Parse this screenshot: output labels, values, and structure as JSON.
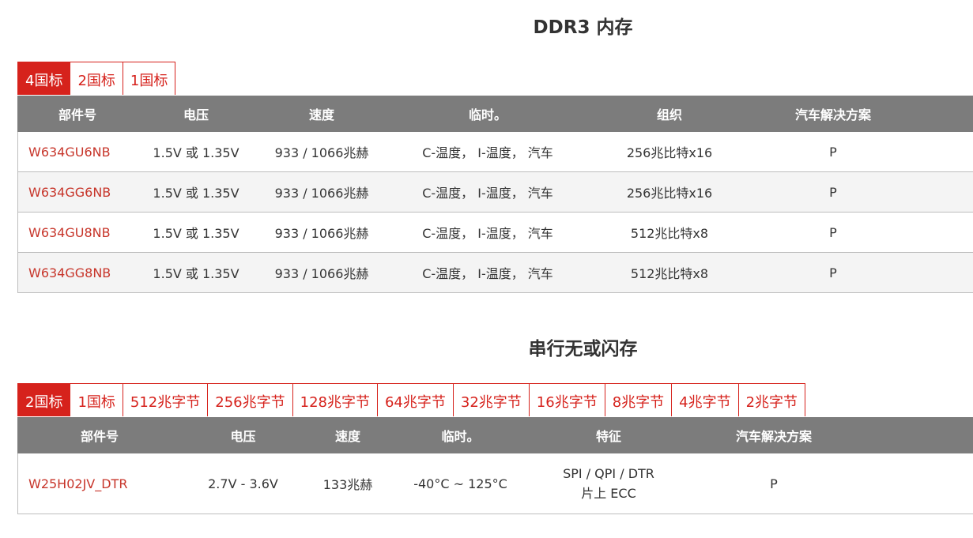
{
  "ddr3": {
    "title": "DDR3 内存",
    "tabs": [
      "4国标",
      "2国标",
      "1国标"
    ],
    "headers": [
      "部件号",
      "电压",
      "速度",
      "临时。",
      "组织",
      "汽车解决方案"
    ],
    "rows": [
      {
        "part": "W634GU6NB",
        "voltage": "1.5V 或 1.35V",
        "speed": "933 / 1066兆赫",
        "temp": "C-温度， I-温度， 汽车",
        "org": "256兆比特x16",
        "auto": "P"
      },
      {
        "part": "W634GG6NB",
        "voltage": "1.5V 或 1.35V",
        "speed": "933 / 1066兆赫",
        "temp": "C-温度， I-温度， 汽车",
        "org": "256兆比特x16",
        "auto": "P"
      },
      {
        "part": "W634GU8NB",
        "voltage": "1.5V 或 1.35V",
        "speed": "933 / 1066兆赫",
        "temp": "C-温度， I-温度， 汽车",
        "org": "512兆比特x8",
        "auto": "P"
      },
      {
        "part": "W634GG8NB",
        "voltage": "1.5V 或 1.35V",
        "speed": "933 / 1066兆赫",
        "temp": "C-温度， I-温度， 汽车",
        "org": "512兆比特x8",
        "auto": "P"
      }
    ]
  },
  "nor": {
    "title": "串行无或闪存",
    "tabs": [
      "2国标",
      "1国标",
      "512兆字节",
      "256兆字节",
      "128兆字节",
      "64兆字节",
      "32兆字节",
      "16兆字节",
      "8兆字节",
      "4兆字节",
      "2兆字节"
    ],
    "headers": [
      "部件号",
      "电压",
      "速度",
      "临时。",
      "特征",
      "汽车解决方案"
    ],
    "rows": [
      {
        "part": "W25H02JV_DTR",
        "voltage": "2.7V - 3.6V",
        "speed": "133兆赫",
        "temp": "-40°C ~ 125°C",
        "feature_line1": "SPI / QPI / DTR",
        "feature_line2": "片上 ECC",
        "auto": "P"
      }
    ]
  },
  "colors": {
    "accent": "#d6221c",
    "header_bg": "#7c7c7c",
    "part_link": "#c7352a"
  }
}
